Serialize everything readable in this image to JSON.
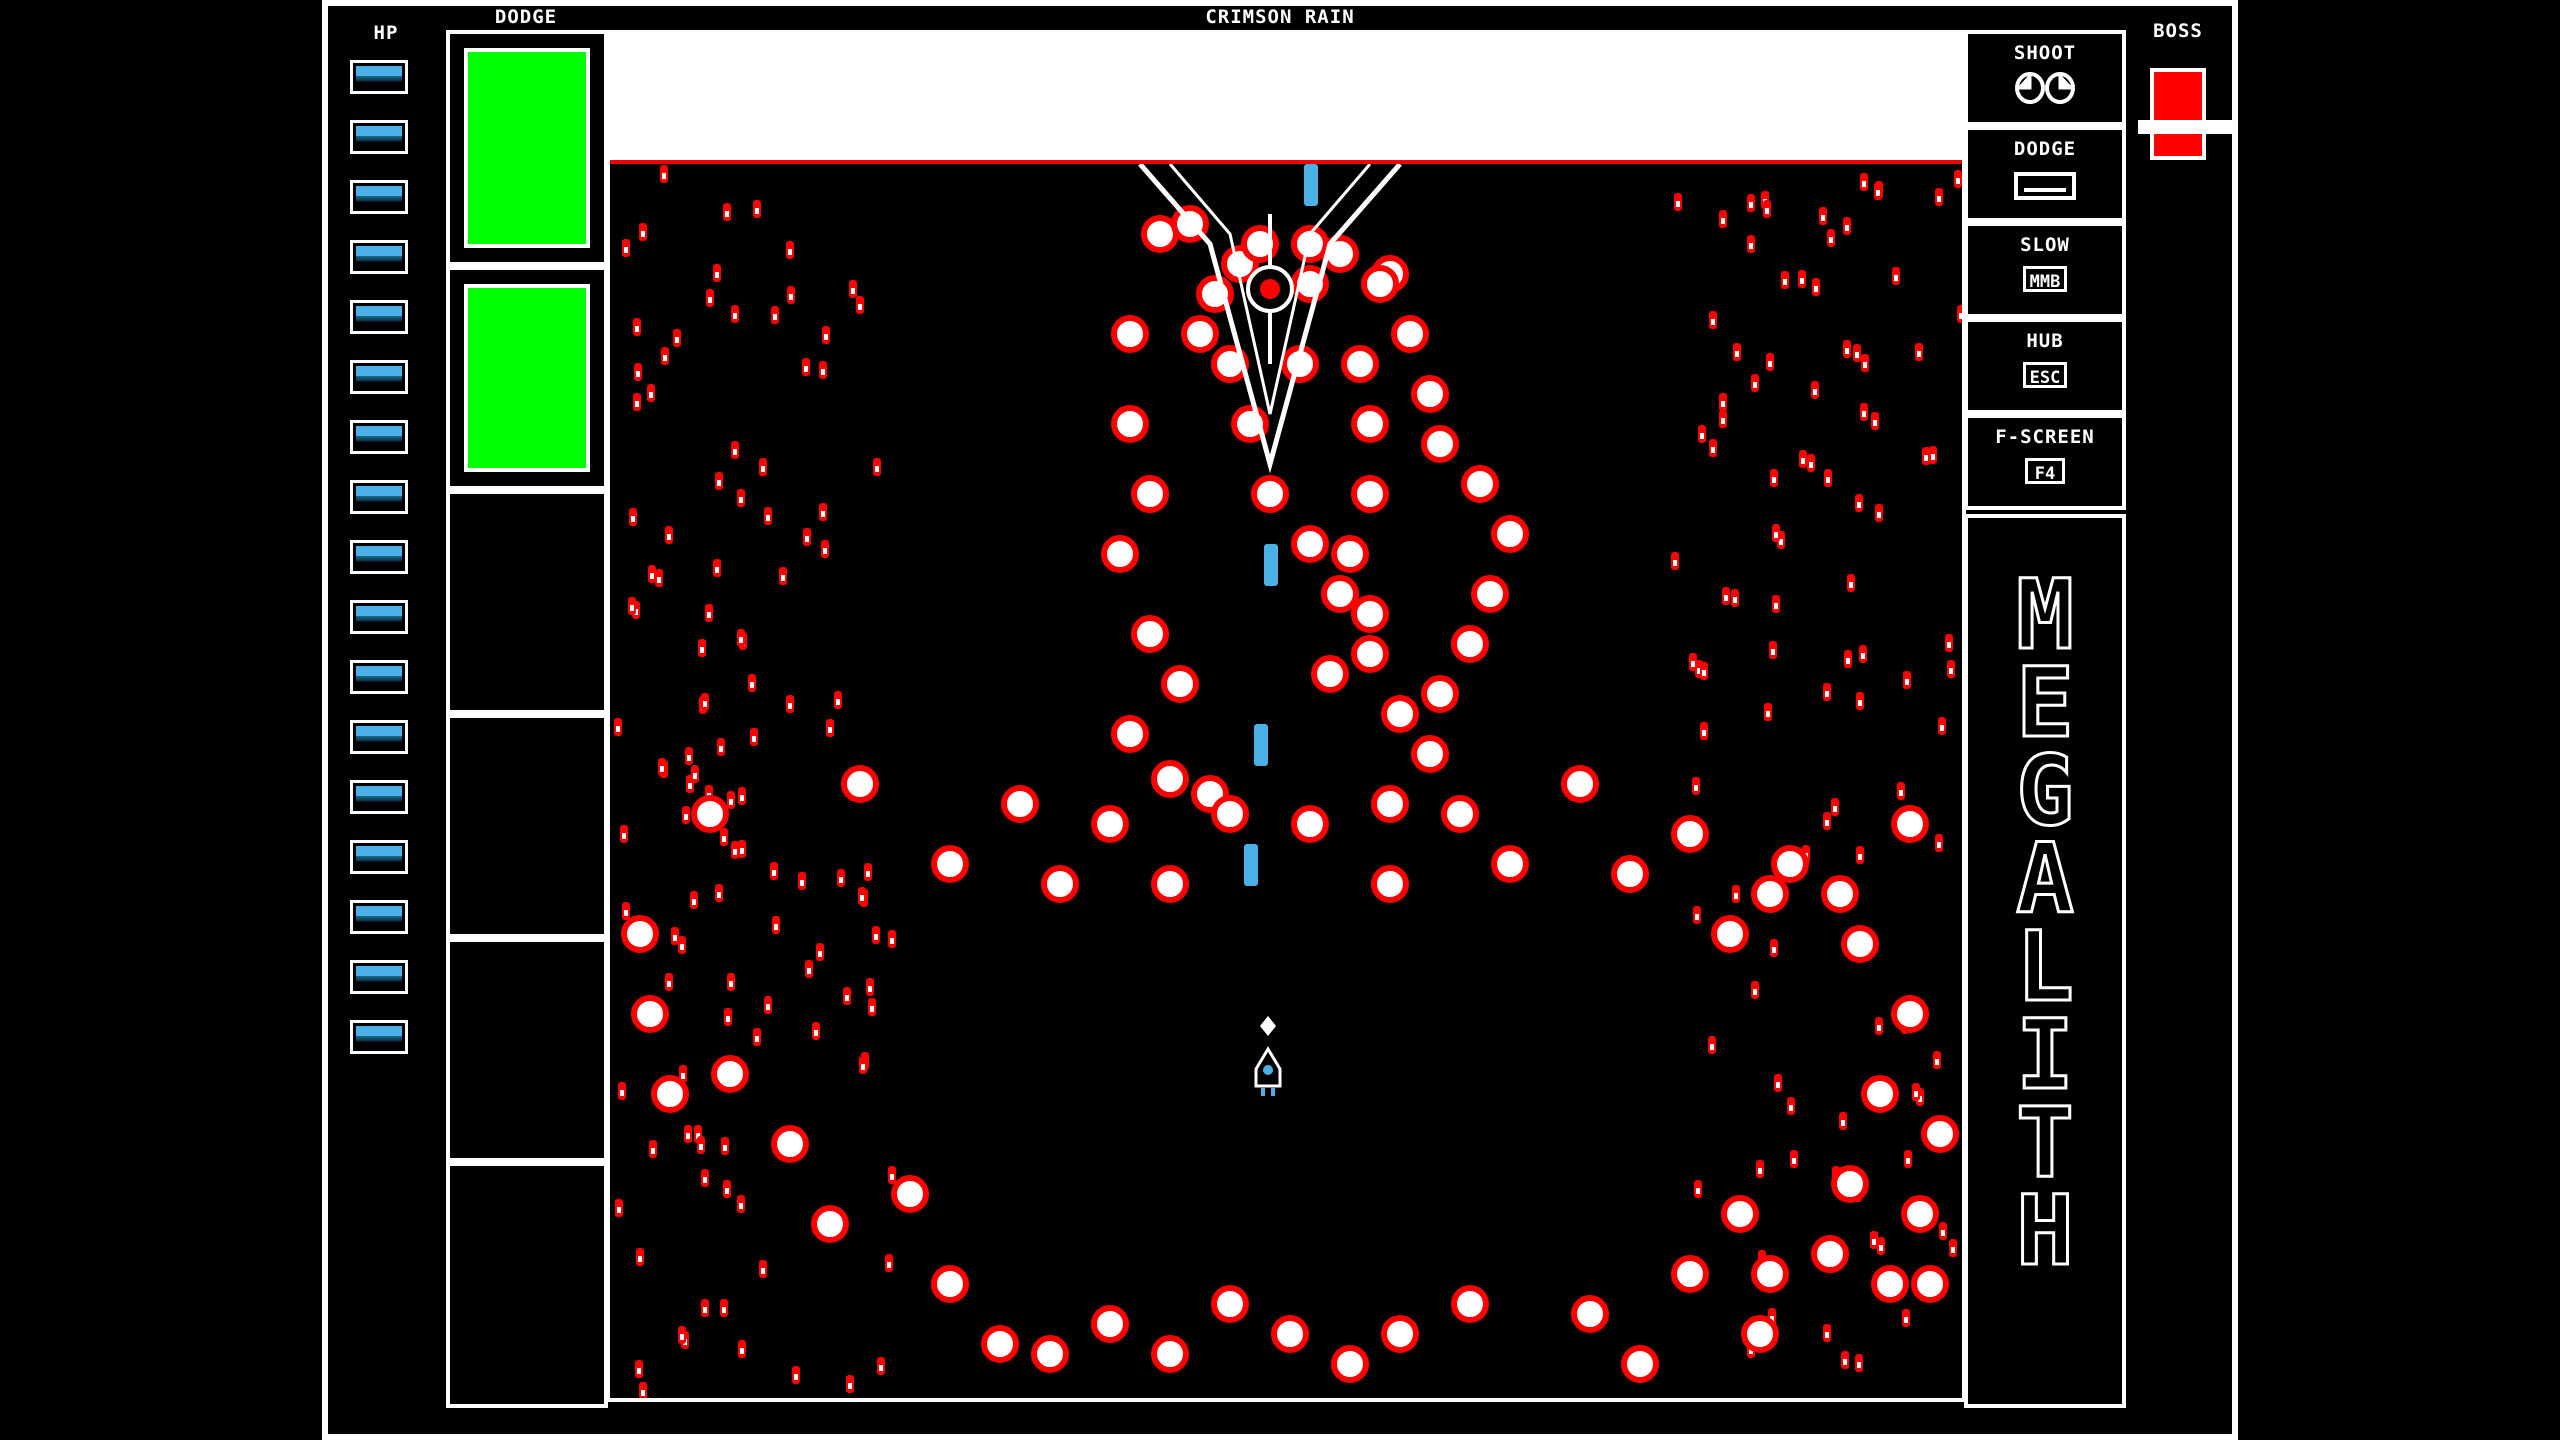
{
  "game": {
    "stage_title": "CRIMSON RAIN",
    "hp_label": "HP",
    "dodge_label": "DODGE",
    "boss_label": "BOSS",
    "hp_pips": 17,
    "dodge_slots_filled": 2,
    "dodge_slots_total": 6,
    "boss_health_fraction": 0.9,
    "logo_text": "MEGALITH"
  },
  "controls": [
    {
      "label": "SHOOT",
      "key": "mouse-buttons-icon"
    },
    {
      "label": "DODGE",
      "key": "spacebar-icon"
    },
    {
      "label": "SLOW",
      "key": "MMB"
    },
    {
      "label": "HUB",
      "key": "ESC"
    },
    {
      "label": "F-SCREEN",
      "key": "F4"
    }
  ],
  "colors": {
    "background": "#000000",
    "foreground": "#ffffff",
    "bullet": "#ff0000",
    "dodge_fill": "#00ff00",
    "boss_health": "#ff0000",
    "player_shot": "#4ab0e6"
  }
}
